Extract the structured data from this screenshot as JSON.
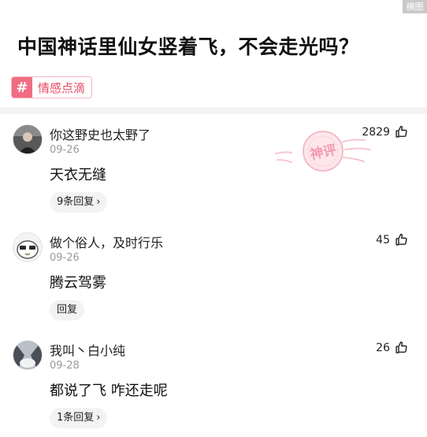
{
  "corner_tag": "横图",
  "post": {
    "title": "中国神话里仙女竖着飞，不会走光吗？",
    "topic_icon": "#",
    "topic": "情感点滴"
  },
  "comments": [
    {
      "nickname": "你这野史也太野了",
      "date": "09-26",
      "text": "天衣无缝",
      "reply_label": "9条回复",
      "likes": "2829"
    },
    {
      "nickname": "做个俗人，及时行乐",
      "date": "09-26",
      "text": "腾云驾雾",
      "reply_label": "回复",
      "likes": "45"
    },
    {
      "nickname": "我叫丶白小纯",
      "date": "09-28",
      "text": "都说了飞  咋还走呢",
      "reply_label": "1条回复",
      "likes": "26"
    }
  ],
  "reply_chevron": "›",
  "watermark": {
    "text": "神评",
    "color": "#f4a9ba"
  },
  "colors": {
    "topic_accent": "#f06d83",
    "topic_text": "#e74a67"
  }
}
